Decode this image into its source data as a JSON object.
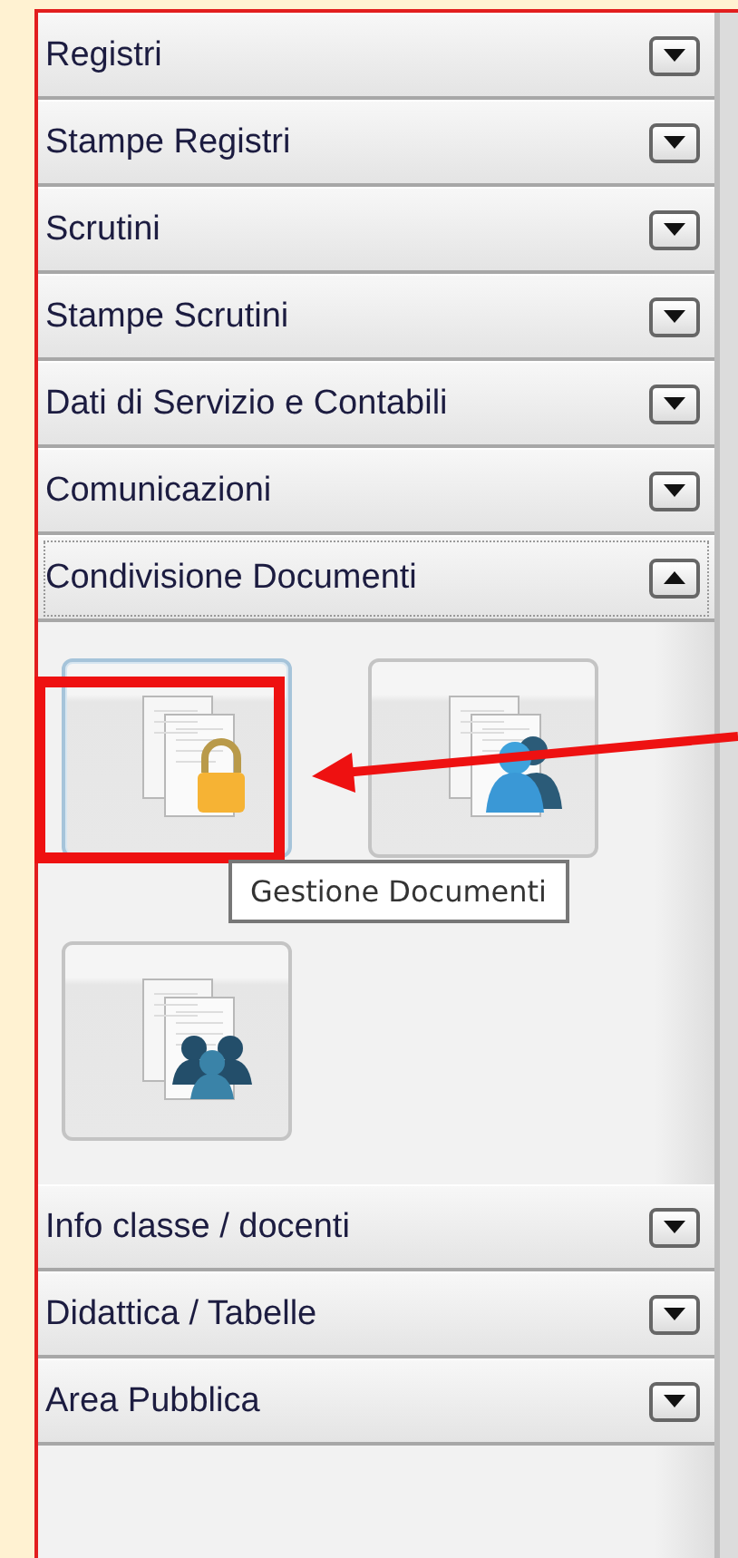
{
  "sections": [
    {
      "label": "Registri",
      "expanded": false
    },
    {
      "label": "Stampe Registri",
      "expanded": false
    },
    {
      "label": "Scrutini",
      "expanded": false
    },
    {
      "label": "Stampe Scrutini",
      "expanded": false
    },
    {
      "label": "Dati di Servizio e Contabili",
      "expanded": false
    },
    {
      "label": "Comunicazioni",
      "expanded": false
    },
    {
      "label": "Condivisione Documenti",
      "expanded": true,
      "items": [
        {
          "kind": "lock",
          "selected": true,
          "tooltip": "Gestione Documenti"
        },
        {
          "kind": "user",
          "selected": false
        },
        {
          "kind": "group",
          "selected": false
        }
      ]
    },
    {
      "label": "Info classe / docenti",
      "expanded": false
    },
    {
      "label": "Didattica / Tabelle",
      "expanded": false
    },
    {
      "label": "Area Pubblica",
      "expanded": false
    }
  ]
}
